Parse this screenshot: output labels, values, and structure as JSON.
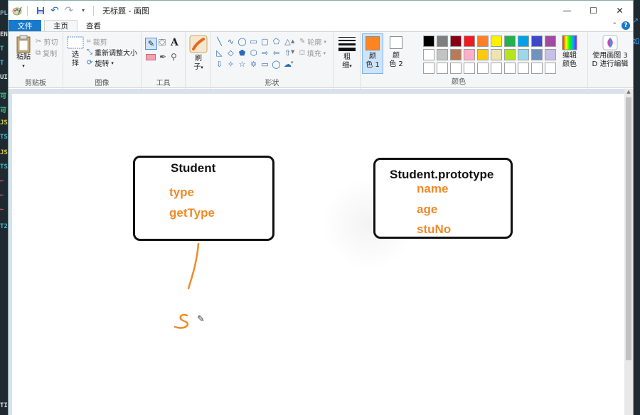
{
  "app": {
    "title": "无标题 - 画图"
  },
  "tabs": [
    {
      "label": "文件"
    },
    {
      "label": "主页"
    },
    {
      "label": "查看"
    }
  ],
  "clipboard": {
    "paste_label": "粘贴",
    "cut_label": "剪切",
    "copy_label": "复制",
    "group_label": "剪贴板"
  },
  "image": {
    "select_label_1": "选",
    "select_label_2": "择",
    "crop_label": "裁剪",
    "resize_label": "重新调整大小",
    "rotate_label": "旋转",
    "group_label": "图像"
  },
  "tools": {
    "group_label": "工具"
  },
  "brushes": {
    "label_1": "刷",
    "label_2": "子"
  },
  "shapes": {
    "outline_label": "轮廓",
    "fill_label": "填充",
    "group_label": "形状"
  },
  "size": {
    "label_1": "粗",
    "label_2": "细"
  },
  "colors": {
    "color1_label_1": "颜",
    "color1_label_2": "色 1",
    "color2_label_1": "颜",
    "color2_label_2": "色 2",
    "color1_value": "#fe8422",
    "color2_value": "#ffffff",
    "edit_label_1": "编辑",
    "edit_label_2": "颜色",
    "paint3d_label_1": "使用画图 3",
    "paint3d_label_2": "D 进行编辑",
    "group_label": "颜色",
    "palette_row1": [
      "#000000",
      "#7f7f7f",
      "#880015",
      "#ed1c24",
      "#ff7f27",
      "#fff200",
      "#22b14c",
      "#00a2e8",
      "#3f48cc",
      "#a349a4"
    ],
    "palette_row2": [
      "#ffffff",
      "#c3c3c3",
      "#b97a57",
      "#ffaec9",
      "#ffc90e",
      "#efe4b0",
      "#b5e61d",
      "#99d9ea",
      "#7092be",
      "#c8bfe7"
    ],
    "palette_row3": [
      "#ffffff",
      "#ffffff",
      "#ffffff",
      "#ffffff",
      "#ffffff",
      "#ffffff",
      "#ffffff",
      "#ffffff",
      "#ffffff",
      "#ffffff"
    ]
  },
  "drawing": {
    "student": {
      "title": "Student",
      "props": [
        "type",
        "getType"
      ]
    },
    "prototype": {
      "title": "Student.prototype",
      "props": [
        "name",
        "age",
        "stuNo"
      ]
    },
    "accent": "#ef8a2a"
  }
}
